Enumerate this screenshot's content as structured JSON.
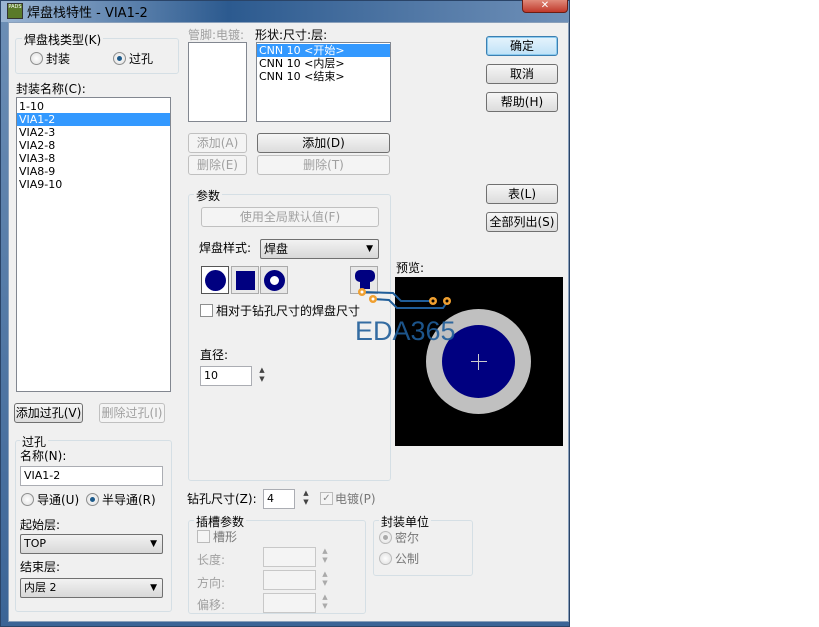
{
  "window": {
    "title": "焊盘栈特性 - VIA1-2",
    "app_icon": "PADS"
  },
  "type_group": {
    "label": "焊盘栈类型(K)",
    "options": [
      {
        "label": "封装",
        "selected": false
      },
      {
        "label": "过孔",
        "selected": true
      }
    ]
  },
  "package_names": {
    "label": "封装名称(C):",
    "items": [
      "1-10",
      "VIA1-2",
      "VIA2-3",
      "VIA2-8",
      "VIA3-8",
      "VIA8-9",
      "VIA9-10"
    ],
    "selected_index": 1
  },
  "via_buttons": {
    "add": "添加过孔(V)",
    "delete": "删除过孔(I)"
  },
  "via_group": {
    "label": "过孔",
    "name_label": "名称(N):",
    "name_value": "VIA1-2",
    "through": "导通(U)",
    "partial": "半导通(R)",
    "partial_selected": true,
    "start_label": "起始层:",
    "start_value": "TOP",
    "end_label": "结束层:",
    "end_value": "内层 2"
  },
  "pins": {
    "label": "管脚:电镀:",
    "add": "添加(A)",
    "delete": "删除(E)"
  },
  "shapes": {
    "label": "形状:尺寸:层:",
    "items": [
      "CNN 10 <开始>",
      "CNN 10 <内层>",
      "CNN 10 <结束>"
    ],
    "selected_index": 0,
    "add": "添加(D)",
    "delete": "删除(T)"
  },
  "params": {
    "label": "参数",
    "use_default": "使用全局默认值(F)",
    "pad_style_label": "焊盘样式:",
    "pad_style_value": "焊盘",
    "relative_size": "相对于钻孔尺寸的焊盘尺寸",
    "diameter_label": "直径:",
    "diameter_value": "10"
  },
  "drill": {
    "label": "钻孔尺寸(Z):",
    "value": "4",
    "plated": "电镀(P)",
    "plated_checked": true
  },
  "slot": {
    "label": "插槽参数",
    "slotted": "槽形",
    "length": "长度:",
    "orientation": "方向:",
    "offset": "偏移:"
  },
  "units": {
    "label": "封装单位",
    "mil": "密尔",
    "metric": "公制",
    "mil_selected": true
  },
  "buttons": {
    "ok": "确定",
    "cancel": "取消",
    "help": "帮助(H)",
    "table": "表(L)",
    "list_all": "全部列出(S)"
  },
  "preview": {
    "label": "预览:"
  },
  "watermark": "EDA365",
  "colors": {
    "pad": "#000080",
    "antipad": "#c0c0c0",
    "preview_bg": "#000000",
    "selection": "#3399ff"
  }
}
